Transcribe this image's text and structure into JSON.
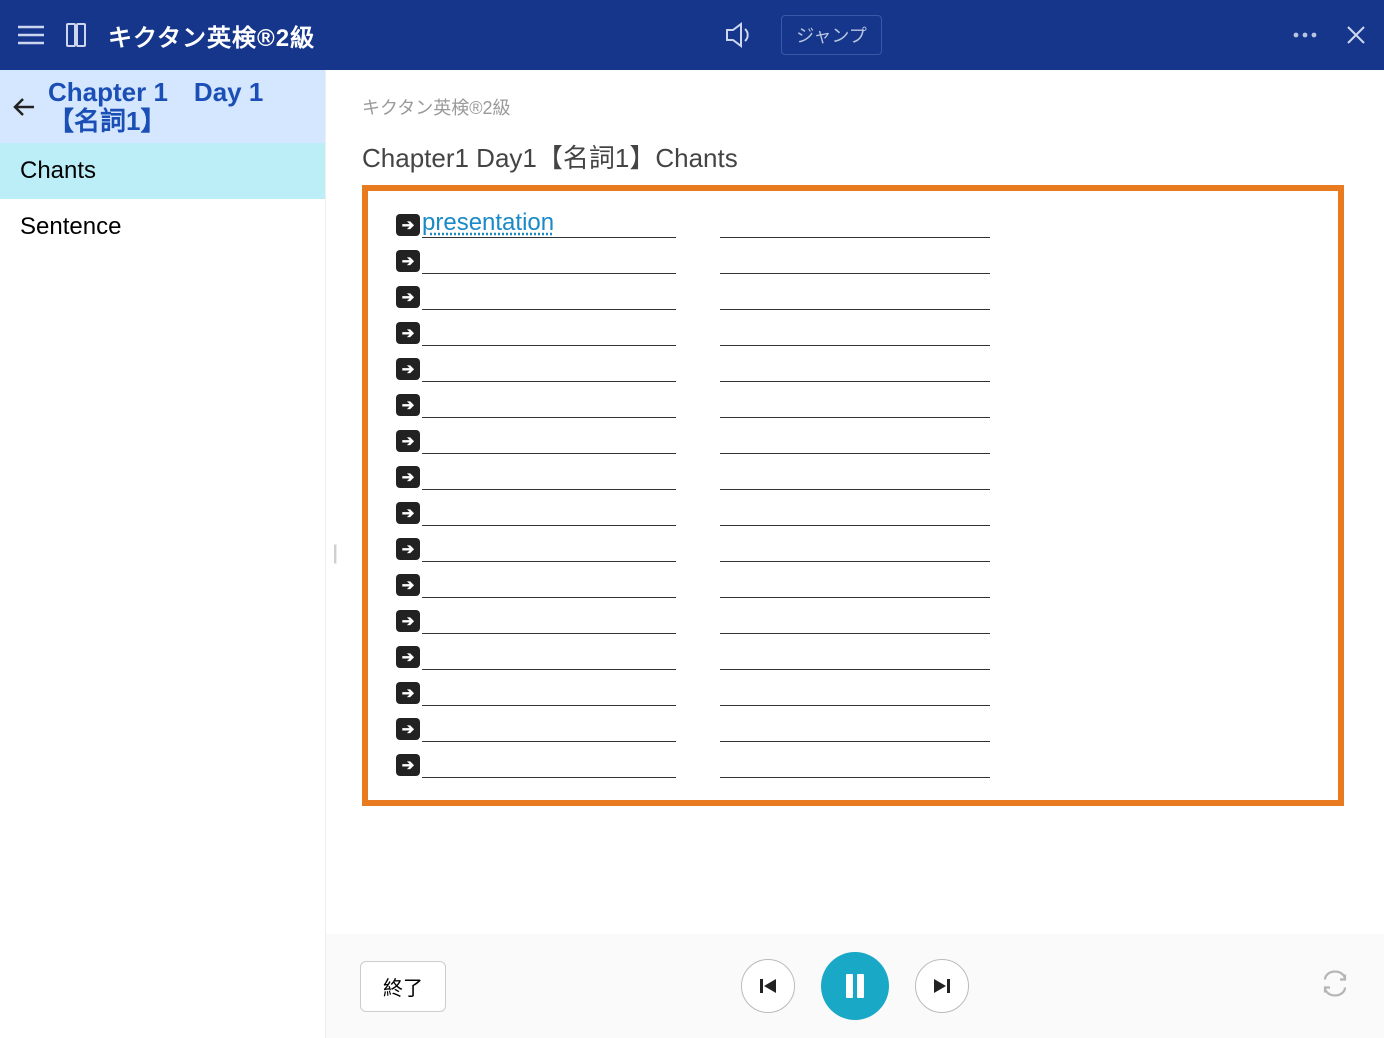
{
  "header": {
    "title": "キクタン英検®2級",
    "jump_label": "ジャンプ"
  },
  "sidebar": {
    "breadcrumb_title": "Chapter 1　Day 1　【名詞1】",
    "items": [
      {
        "label": "Chants",
        "active": true
      },
      {
        "label": "Sentence",
        "active": false
      }
    ]
  },
  "content": {
    "breadcrumb": "キクタン英検®2級",
    "section_title": "Chapter1 Day1【名詞1】Chants",
    "rows": [
      {
        "word": "presentation",
        "link": true
      },
      {
        "word": "",
        "link": false
      },
      {
        "word": "",
        "link": false
      },
      {
        "word": "",
        "link": false
      },
      {
        "word": "",
        "link": false
      },
      {
        "word": "",
        "link": false
      },
      {
        "word": "",
        "link": false
      },
      {
        "word": "",
        "link": false
      },
      {
        "word": "",
        "link": false
      },
      {
        "word": "",
        "link": false
      },
      {
        "word": "",
        "link": false
      },
      {
        "word": "",
        "link": false
      },
      {
        "word": "",
        "link": false
      },
      {
        "word": "",
        "link": false
      },
      {
        "word": "",
        "link": false
      },
      {
        "word": "",
        "link": false
      }
    ]
  },
  "footer": {
    "end_label": "終了"
  }
}
